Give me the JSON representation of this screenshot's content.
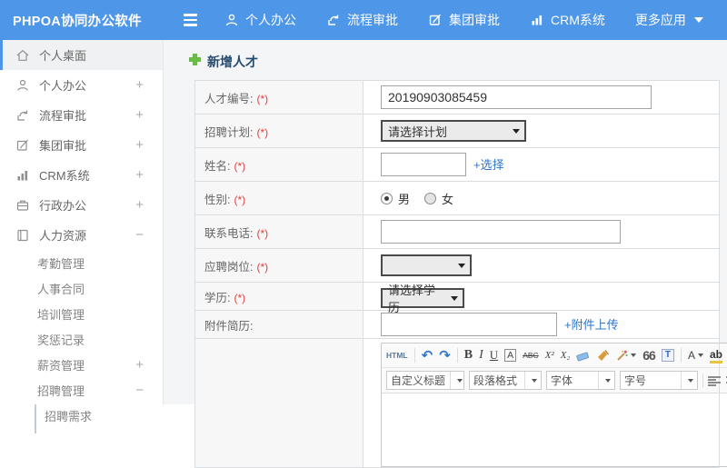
{
  "navbar": {
    "brand": "PHPOA协同办公软件",
    "items": [
      {
        "label": "个人办公"
      },
      {
        "label": "流程审批"
      },
      {
        "label": "集团审批"
      },
      {
        "label": "CRM系统"
      },
      {
        "label": "更多应用"
      }
    ]
  },
  "sidebar": {
    "items": [
      {
        "label": "个人桌面",
        "toggle": ""
      },
      {
        "label": "个人办公",
        "toggle": "+"
      },
      {
        "label": "流程审批",
        "toggle": "+"
      },
      {
        "label": "集团审批",
        "toggle": "+"
      },
      {
        "label": "CRM系统",
        "toggle": "+"
      },
      {
        "label": "行政办公",
        "toggle": "+"
      },
      {
        "label": "人力资源",
        "toggle": "−"
      }
    ],
    "hr_submenu": [
      {
        "label": "考勤管理",
        "toggle": ""
      },
      {
        "label": "人事合同",
        "toggle": ""
      },
      {
        "label": "培训管理",
        "toggle": ""
      },
      {
        "label": "奖惩记录",
        "toggle": ""
      },
      {
        "label": "薪资管理",
        "toggle": "+"
      },
      {
        "label": "招聘管理",
        "toggle": "−"
      },
      {
        "label": "招聘需求",
        "toggle": ""
      }
    ]
  },
  "main": {
    "title": "新增人才",
    "required_mark": "(*)",
    "form": {
      "rows": [
        {
          "label": "人才编号:",
          "value": "20190903085459"
        },
        {
          "label": "招聘计划:",
          "select_value": "请选择计划"
        },
        {
          "label": "姓名:",
          "value": "",
          "link": "+选择"
        },
        {
          "label": "性别:",
          "options": [
            "男",
            "女"
          ],
          "selected": "男"
        },
        {
          "label": "联系电话:",
          "value": ""
        },
        {
          "label": "应聘岗位:",
          "select_value": ""
        },
        {
          "label": "学历:",
          "select_value": "请选择学历"
        },
        {
          "label": "附件简历:",
          "value": "",
          "link": "+附件上传"
        }
      ]
    }
  },
  "editor": {
    "toolbar1": {
      "html": "HTML",
      "undo": "↶",
      "redo": "↷",
      "bold": "B",
      "italic": "I",
      "underline": "U",
      "font_border": "A",
      "strike": "ABC",
      "superscript": "X²",
      "subscript": "X₂",
      "quote": "66",
      "date": "T",
      "font_color": "A",
      "highlight": "ab"
    },
    "toolbar2": {
      "dropdowns": [
        "自定义标题",
        "段落格式",
        "字体",
        "字号"
      ]
    }
  }
}
